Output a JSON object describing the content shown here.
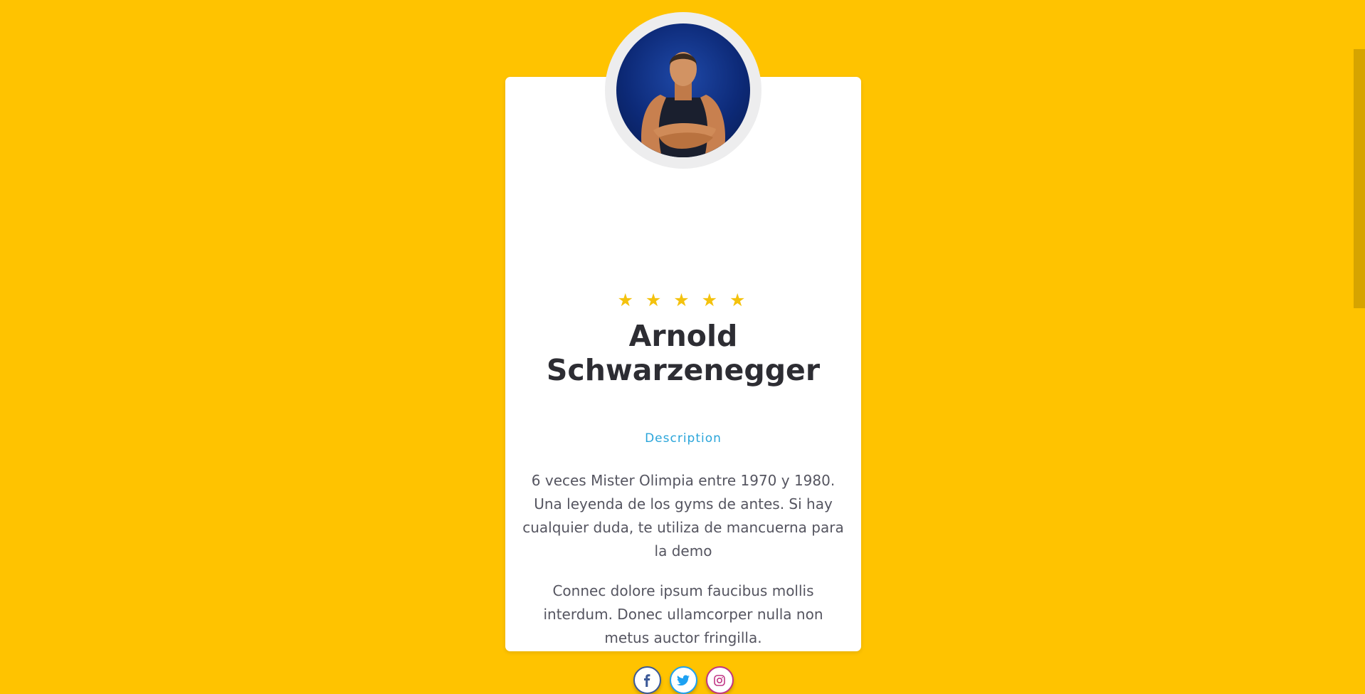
{
  "profile": {
    "rating": 5,
    "stars": [
      "★",
      "★",
      "★",
      "★",
      "★"
    ],
    "name_line1": "Arnold",
    "name_line2": "Schwarzenegger",
    "description_label": "Description",
    "paragraph1": "6 veces Mister Olimpia entre 1970 y 1980. Una leyenda de los gyms de antes. Si hay cualquier duda, te utiliza de mancuerna para la demo",
    "paragraph2": "Connec dolore ipsum faucibus mollis interdum. Donec ullamcorper nulla non metus auctor fringilla."
  },
  "socials": [
    {
      "icon": "facebook-icon",
      "color": "#3B5998"
    },
    {
      "icon": "twitter-icon",
      "color": "#1DA1F2"
    },
    {
      "icon": "instagram-icon",
      "color": "#C13584"
    }
  ],
  "colors": {
    "background": "#FFC300",
    "card": "#FFFFFF",
    "star": "#F4C20D",
    "accent": "#2AA5DA",
    "heading": "#2D2D33",
    "body_text": "#555560"
  }
}
